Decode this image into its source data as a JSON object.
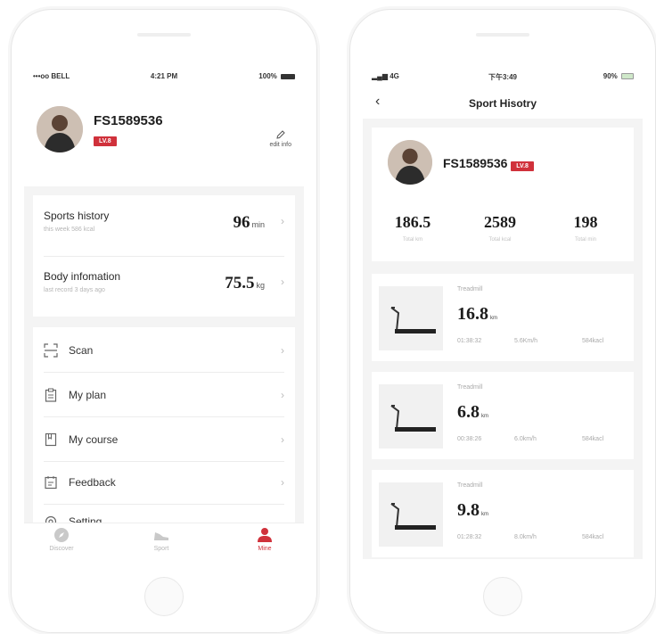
{
  "left": {
    "status": {
      "carrier": "•••oo BELL",
      "time": "4:21 PM",
      "battery": "100%"
    },
    "profile": {
      "name": "FS1589536",
      "level": "LV.8",
      "edit_label": "edit info"
    },
    "stats": [
      {
        "title": "Sports history",
        "subtitle": "this week 586 kcal",
        "value": "96",
        "unit": "min"
      },
      {
        "title": "Body infomation",
        "subtitle": "last record 3 days ago",
        "value": "75.5",
        "unit": "kg"
      }
    ],
    "menu": [
      {
        "label": "Scan",
        "icon": "scan-icon"
      },
      {
        "label": "My plan",
        "icon": "clipboard-icon"
      },
      {
        "label": "My course",
        "icon": "bookmark-icon"
      },
      {
        "label": "Feedback",
        "icon": "feedback-icon"
      },
      {
        "label": "Setting",
        "icon": "gear-icon"
      }
    ],
    "tabs": [
      {
        "label": "Discover",
        "icon": "compass-icon"
      },
      {
        "label": "Sport",
        "icon": "shoe-icon"
      },
      {
        "label": "Mine",
        "icon": "person-icon"
      }
    ],
    "accent": "#d0313b"
  },
  "right": {
    "status": {
      "signal": "4G",
      "time": "下午3:49",
      "battery": "90%"
    },
    "title": "Sport Hisotry",
    "profile": {
      "name": "FS1589536",
      "level": "LV.8"
    },
    "totals": [
      {
        "value": "186.5",
        "label": "Total  km"
      },
      {
        "value": "2589",
        "label": "Total  kcal"
      },
      {
        "value": "198",
        "label": "Total min"
      }
    ],
    "records": [
      {
        "type": "Treadmill",
        "distance": "16.8",
        "unit": "km",
        "time": "01:38:32",
        "speed": "5.6Km/h",
        "kcal": "584kacl"
      },
      {
        "type": "Treadmill",
        "distance": "6.8",
        "unit": "km",
        "time": "00:38:26",
        "speed": "6.0km/h",
        "kcal": "584kacl"
      },
      {
        "type": "Treadmill",
        "distance": "9.8",
        "unit": "km",
        "time": "01:28:32",
        "speed": "8.0km/h",
        "kcal": "584kacl"
      }
    ]
  }
}
